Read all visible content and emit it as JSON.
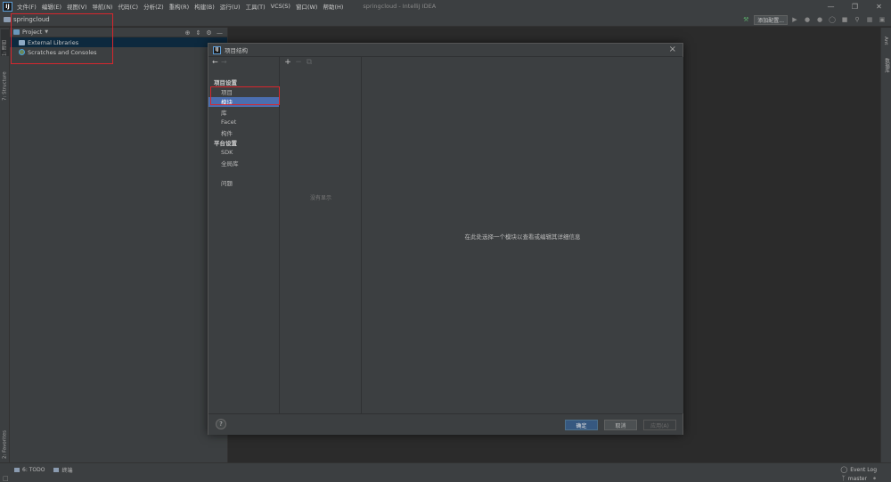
{
  "menubar": {
    "items": [
      "文件(F)",
      "编辑(E)",
      "视图(V)",
      "导航(N)",
      "代码(C)",
      "分析(Z)",
      "重构(R)",
      "构建(B)",
      "运行(U)",
      "工具(T)",
      "VCS(S)",
      "窗口(W)",
      "帮助(H)"
    ],
    "window_title": "springcloud - IntelliJ IDEA"
  },
  "navbar": {
    "project_name": "springcloud",
    "add_config_label": "添加配置..."
  },
  "left_strip": {
    "project_tab": "1: 项目",
    "structure_tab": "7: Structure",
    "favorites_tab": "2: Favorites"
  },
  "right_strip": {
    "ant_tab": "Ant",
    "database_tab": "数据库"
  },
  "project_panel": {
    "title": "Project",
    "tree": [
      "External Libraries",
      "Scratches and Consoles"
    ]
  },
  "dialog": {
    "title": "项目结构",
    "project_settings_group": "项目设置",
    "project_settings_items": [
      "项目",
      "模块",
      "库",
      "Facet",
      "构件"
    ],
    "platform_settings_group": "平台设置",
    "platform_settings_items": [
      "SDK",
      "全局库"
    ],
    "problems_item": "问题",
    "empty_text": "没有显示",
    "detail_text": "在此处选择一个模块以查看或编辑其详细信息",
    "ok_label": "确定",
    "cancel_label": "取消",
    "apply_label": "应用(A)",
    "help_label": "?"
  },
  "statusbar": {
    "todo_label": "6: TODO",
    "terminal_label": "终端",
    "event_log_label": "Event Log",
    "branch_label": "master"
  },
  "colors": {
    "highlight": "#d7262d",
    "selection": "#4b6eaf",
    "primary_button": "#365880"
  }
}
